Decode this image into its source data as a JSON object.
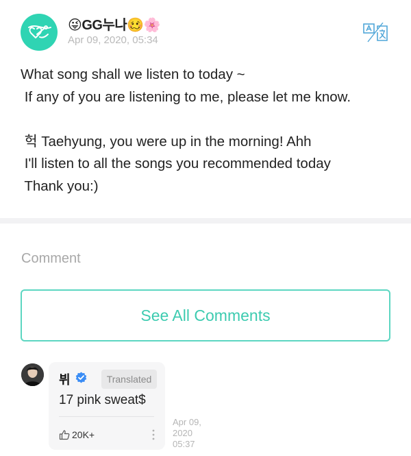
{
  "post": {
    "author": "😜GG누나🥴🌸",
    "date": "Apr 09, 2020, 05:34",
    "translate_icon": "translate-icon",
    "body_lines": [
      "What song shall we listen to today ~",
      " If any of you are listening to me, please let me know.",
      "",
      " 헉 Taehyung, you were up in the morning! Ahh",
      " I'll listen to all the songs you recommended today",
      " Thank you:)"
    ]
  },
  "comments_section": {
    "heading": "Comment",
    "see_all_label": "See All Comments"
  },
  "comment": {
    "author": "뷔",
    "verified_icon": "verified-check-icon",
    "translated_label": "Translated",
    "text": "17 pink sweat$",
    "likes": "20K+",
    "date": "Apr 09, 2020 05:37"
  },
  "colors": {
    "accent": "#3dcbb0",
    "accent_border": "#5cd6c1",
    "avatar_bg": "#2fd4b3",
    "verified": "#3b8df5",
    "muted_text": "#b9b9b9"
  }
}
